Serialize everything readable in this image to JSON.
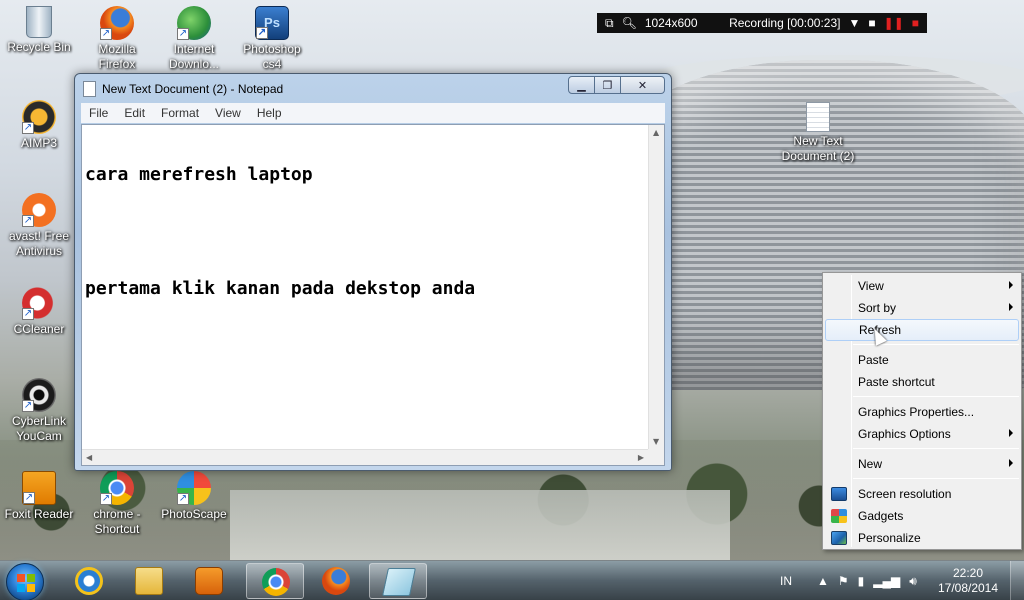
{
  "desktop": {
    "icons": [
      {
        "label": "Recycle Bin"
      },
      {
        "label": "Mozilla Firefox"
      },
      {
        "label": "Internet Downlo..."
      },
      {
        "label": "Photoshop cs4"
      },
      {
        "label": "AIMP3"
      },
      {
        "label": "avast! Free Antivirus"
      },
      {
        "label": "CCleaner"
      },
      {
        "label": "CyberLink YouCam"
      },
      {
        "label": "Foxit Reader"
      },
      {
        "label": "chrome - Shortcut"
      },
      {
        "label": "PhotoScape"
      },
      {
        "label": "New Text Document (2)"
      }
    ]
  },
  "recorder": {
    "resolution": "1024x600",
    "status": "Recording [00:00:23]"
  },
  "notepad": {
    "title": "New Text Document (2) - Notepad",
    "menu": [
      "File",
      "Edit",
      "Format",
      "View",
      "Help"
    ],
    "lines": [
      "cara merefresh laptop",
      "",
      "pertama klik kanan pada dekstop anda"
    ]
  },
  "context_menu": {
    "items": [
      {
        "label": "View"
      },
      {
        "label": "Sort by"
      },
      {
        "label": "Refresh"
      },
      {
        "label": "Paste"
      },
      {
        "label": "Paste shortcut"
      },
      {
        "label": "Graphics Properties..."
      },
      {
        "label": "Graphics Options"
      },
      {
        "label": "New"
      },
      {
        "label": "Screen resolution"
      },
      {
        "label": "Gadgets"
      },
      {
        "label": "Personalize"
      }
    ],
    "highlighted": "Refresh"
  },
  "taskbar": {
    "language": "IN",
    "time": "22:20",
    "date": "17/08/2014"
  },
  "colors": {
    "accent": "#3399ff",
    "record_red": "#e02020",
    "menu_highlight": "#aecff7"
  }
}
